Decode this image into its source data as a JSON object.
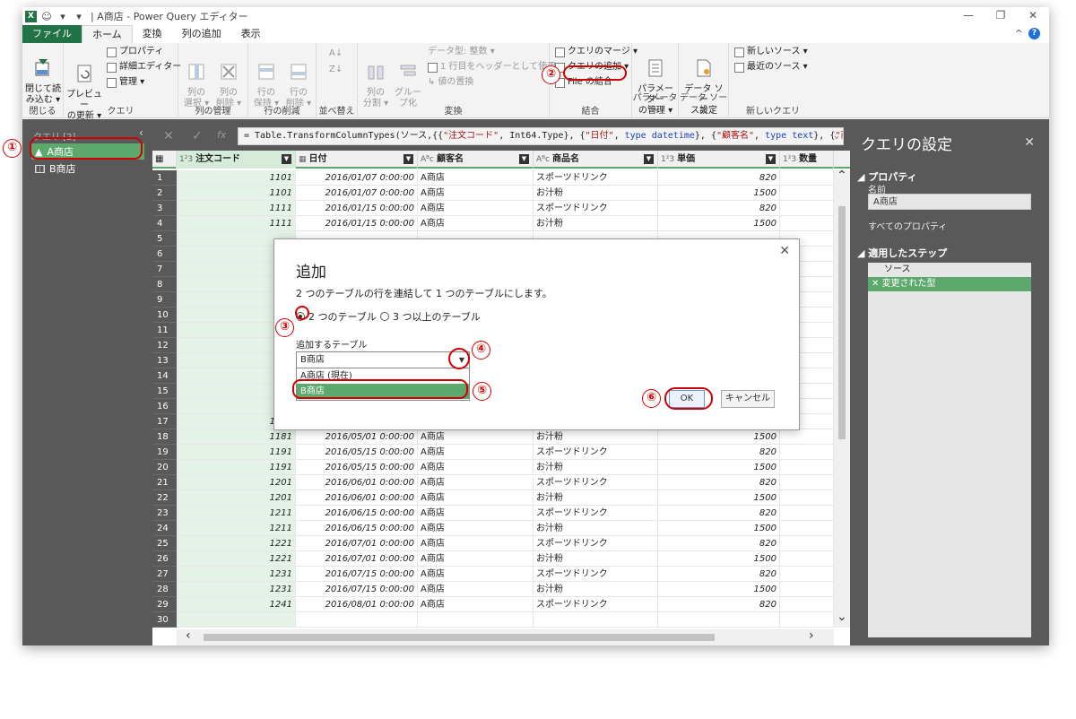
{
  "window": {
    "title": "| A商店 - Power Query エディター",
    "help_caret": "^",
    "help": "?"
  },
  "tabs": [
    "ファイル",
    "ホーム",
    "変換",
    "列の追加",
    "表示"
  ],
  "ribbon": {
    "close_load": "閉じて読\nみ込む ▾",
    "preview_refresh": "プレビュー\nの更新 ▾",
    "properties": "プロパティ",
    "advanced_editor": "詳細エディター",
    "manage": "管理 ▾",
    "select_columns": "列の\n選択 ▾",
    "remove_columns": "列の\n削除 ▾",
    "keep_rows": "行の\n保持 ▾",
    "remove_rows": "行の\n削除 ▾",
    "split_column": "列の\n分割 ▾",
    "group_by": "グルー\nプ化",
    "data_type": "データ型: 整数 ▾",
    "use_header": "1 行目をヘッダーとして使用 ▾",
    "replace_values": "値の置換",
    "merge_queries": "クエリのマージ ▾",
    "append_queries": "クエリの追加 ▾",
    "combine_files": "File の結合",
    "manage_params": "パラメーター\nの管理 ▾",
    "data_source": "データ ソー\nス設定",
    "new_source": "新しいソース ▾",
    "recent_source": "最近のソース ▾",
    "groups": [
      "閉じる",
      "クエリ",
      "列の管理",
      "行の削減",
      "並べ替え",
      "変換",
      "結合",
      "パラメーター",
      "データ ソース",
      "新しいクエリ"
    ]
  },
  "queries": {
    "header": "クエリ [2]",
    "items": [
      "A商店",
      "B商店"
    ]
  },
  "formula": {
    "prefix": "= Table.TransformColumnTypes(ソース,{{",
    "s1": "\"注文コード\"",
    "m1": ", Int64.Type}, {",
    "s2": "\"日付\"",
    "m2": ", ",
    "k1": "type datetime",
    "m3": "}, {",
    "s3": "\"顧客名\"",
    "m4": ", ",
    "k2": "type text",
    "m5": "}, {",
    "s4": "\"商"
  },
  "columns": [
    {
      "type": "1²3",
      "name": "注文コード"
    },
    {
      "type": "▦",
      "name": "日付"
    },
    {
      "type": "Aᴮc",
      "name": "顧客名"
    },
    {
      "type": "Aᴮc",
      "name": "商品名"
    },
    {
      "type": "1²3",
      "name": "単価"
    },
    {
      "type": "1²3",
      "name": "数量"
    }
  ],
  "rows": [
    [
      "1",
      "1101",
      "2016/01/07 0:00:00",
      "A商店",
      "スポーツドリンク",
      "820"
    ],
    [
      "2",
      "1101",
      "2016/01/07 0:00:00",
      "A商店",
      "お汁粉",
      "1500"
    ],
    [
      "3",
      "1111",
      "2016/01/15 0:00:00",
      "A商店",
      "スポーツドリンク",
      "820"
    ],
    [
      "4",
      "1111",
      "2016/01/15 0:00:00",
      "A商店",
      "お汁粉",
      "1500"
    ],
    [
      "5",
      "",
      "",
      "",
      "",
      ""
    ],
    [
      "6",
      "",
      "",
      "",
      "",
      ""
    ],
    [
      "7",
      "",
      "",
      "",
      "",
      ""
    ],
    [
      "8",
      "",
      "",
      "",
      "",
      ""
    ],
    [
      "9",
      "",
      "",
      "",
      "",
      ""
    ],
    [
      "10",
      "",
      "",
      "",
      "",
      ""
    ],
    [
      "11",
      "",
      "",
      "",
      "",
      ""
    ],
    [
      "12",
      "",
      "",
      "",
      "",
      ""
    ],
    [
      "13",
      "",
      "",
      "",
      "",
      ""
    ],
    [
      "14",
      "",
      "",
      "",
      "",
      ""
    ],
    [
      "15",
      "",
      "",
      "",
      "",
      ""
    ],
    [
      "16",
      "",
      "",
      "",
      "",
      ""
    ],
    [
      "17",
      "1181",
      "2016/05/01 0:00:00",
      "A商店",
      "スポーツドリンク",
      "820"
    ],
    [
      "18",
      "1181",
      "2016/05/01 0:00:00",
      "A商店",
      "お汁粉",
      "1500"
    ],
    [
      "19",
      "1191",
      "2016/05/15 0:00:00",
      "A商店",
      "スポーツドリンク",
      "820"
    ],
    [
      "20",
      "1191",
      "2016/05/15 0:00:00",
      "A商店",
      "お汁粉",
      "1500"
    ],
    [
      "21",
      "1201",
      "2016/06/01 0:00:00",
      "A商店",
      "スポーツドリンク",
      "820"
    ],
    [
      "22",
      "1201",
      "2016/06/01 0:00:00",
      "A商店",
      "お汁粉",
      "1500"
    ],
    [
      "23",
      "1211",
      "2016/06/15 0:00:00",
      "A商店",
      "スポーツドリンク",
      "820"
    ],
    [
      "24",
      "1211",
      "2016/06/15 0:00:00",
      "A商店",
      "お汁粉",
      "1500"
    ],
    [
      "25",
      "1221",
      "2016/07/01 0:00:00",
      "A商店",
      "スポーツドリンク",
      "820"
    ],
    [
      "26",
      "1221",
      "2016/07/01 0:00:00",
      "A商店",
      "お汁粉",
      "1500"
    ],
    [
      "27",
      "1231",
      "2016/07/15 0:00:00",
      "A商店",
      "スポーツドリンク",
      "820"
    ],
    [
      "28",
      "1231",
      "2016/07/15 0:00:00",
      "A商店",
      "お汁粉",
      "1500"
    ],
    [
      "29",
      "1241",
      "2016/08/01 0:00:00",
      "A商店",
      "スポーツドリンク",
      "820"
    ],
    [
      "30",
      "",
      "",
      "",
      "",
      ""
    ]
  ],
  "settings": {
    "title": "クエリの設定",
    "properties": "◢ プロパティ",
    "name_label": "名前",
    "name_value": "A商店",
    "all_props": "すべてのプロパティ",
    "applied_steps": "◢ 適用したステップ",
    "steps": [
      "ソース",
      "変更された型"
    ]
  },
  "dialog": {
    "title": "追加",
    "desc": "2 つのテーブルの行を連結して 1 つのテーブルにします。",
    "opt1": "2 つのテーブル",
    "opt2": "3 つ以上のテーブル",
    "table_label": "追加するテーブル",
    "combo_value": "B商店",
    "options": [
      "A商店 (現在)",
      "B商店"
    ],
    "ok": "OK",
    "cancel": "キャンセル"
  },
  "markers": [
    "①",
    "②",
    "③",
    "④",
    "⑤",
    "⑥"
  ],
  "colors": {
    "excel_green": "#217346",
    "selection_green": "#5ca86d",
    "marker_red": "#d10000",
    "pane_gray": "#595959"
  }
}
